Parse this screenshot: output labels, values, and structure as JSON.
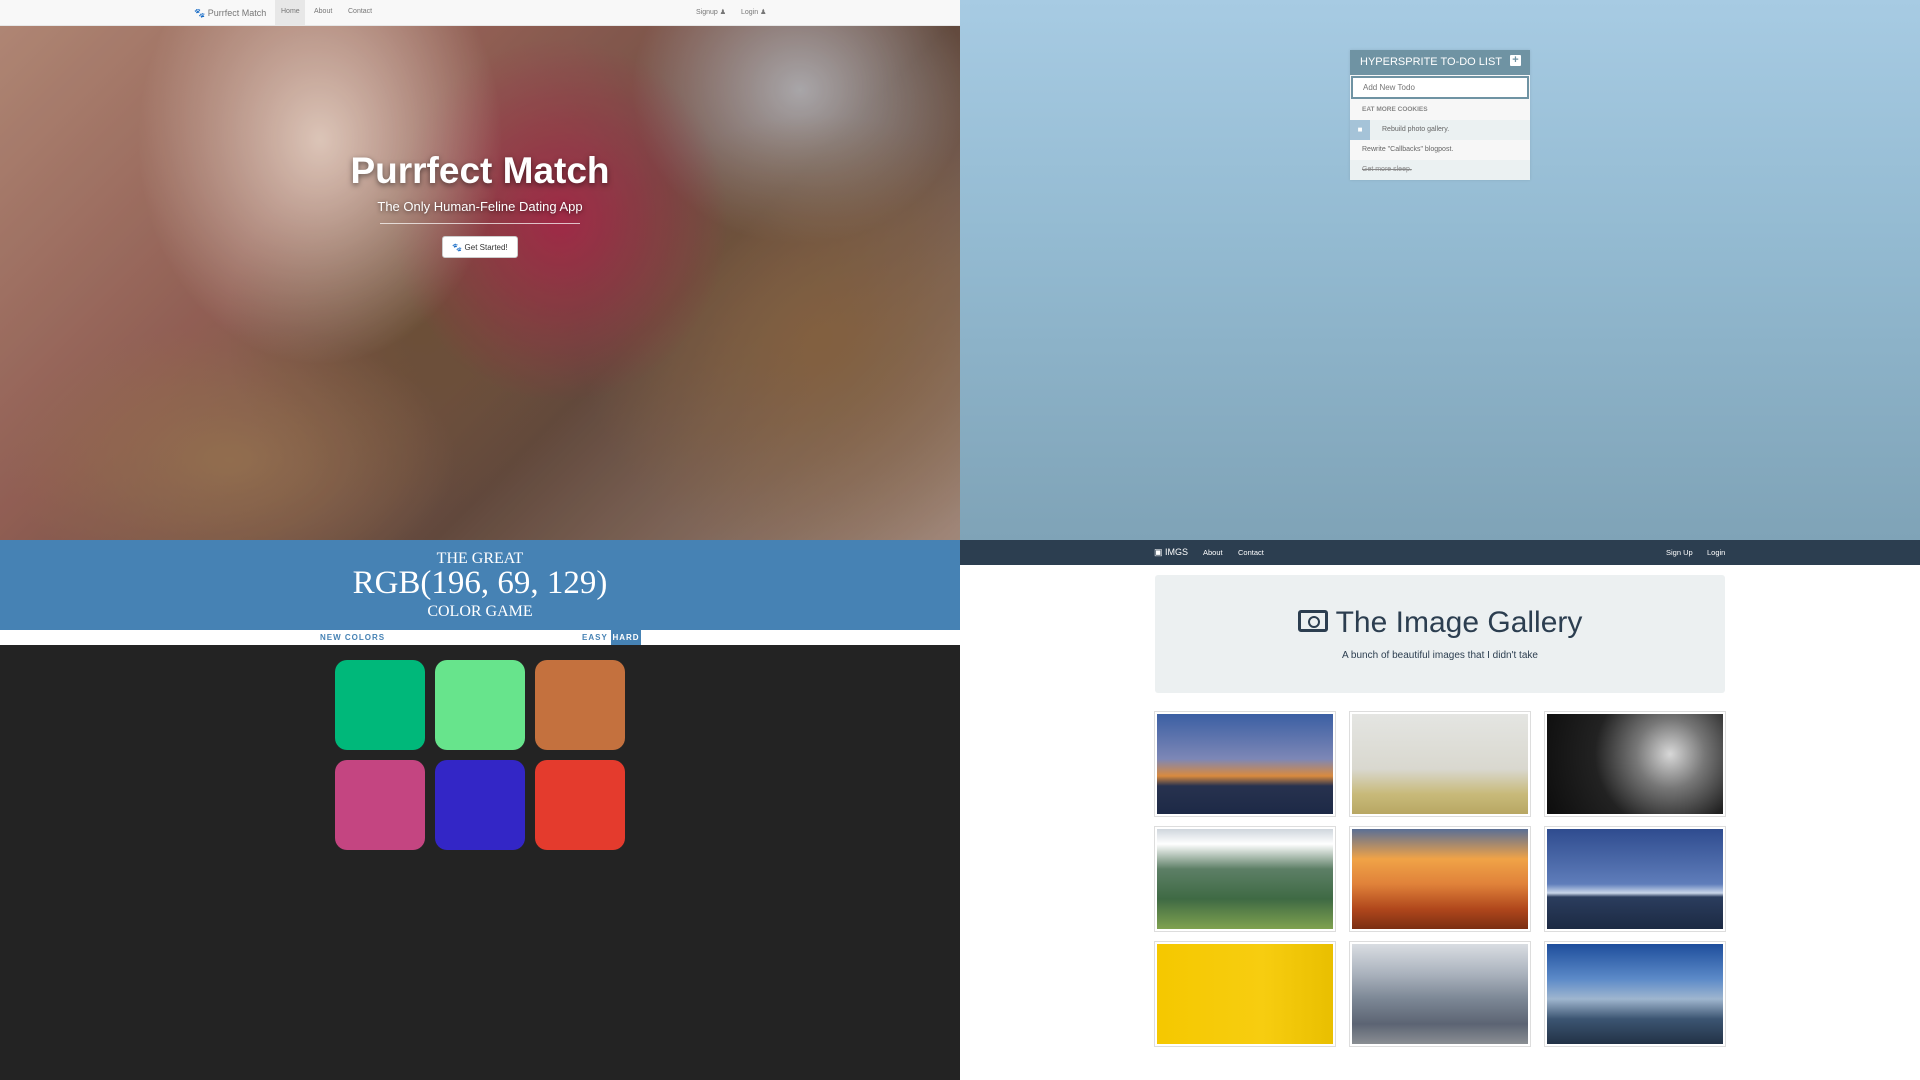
{
  "purrfect": {
    "brand": "Purrfect Match",
    "nav": [
      "Home",
      "About",
      "Contact"
    ],
    "signup": "Signup",
    "login": "Login",
    "title": "Purrfect Match",
    "subtitle": "The Only Human-Feline Dating App",
    "cta": "Get Started!"
  },
  "todo": {
    "title": "HYPERSPRITE TO-DO LIST",
    "placeholder": "Add New Todo",
    "items": [
      {
        "text": "EAT MORE COOKIES",
        "style": "header"
      },
      {
        "text": "Rebuild photo gallery.",
        "style": "hover"
      },
      {
        "text": "Rewrite \"Callbacks\" blogpost.",
        "style": "normal"
      },
      {
        "text": "Get more sleep.",
        "style": "done"
      }
    ]
  },
  "colorgame": {
    "line1": "THE GREAT",
    "rgb": "RGB(196, 69, 129)",
    "line3": "COLOR GAME",
    "new_colors": "NEW COLORS",
    "easy": "EASY",
    "hard": "HARD",
    "squares": [
      "#00b87a",
      "#67e48c",
      "#c4713e",
      "#c44581",
      "#3326c6",
      "#e43b2d"
    ]
  },
  "gallery": {
    "brand": "IMGS",
    "nav": [
      "About",
      "Contact"
    ],
    "signup": "Sign Up",
    "login": "Login",
    "title": "The Image Gallery",
    "subtitle": "A bunch of beautiful images that I didn't take",
    "thumbs": [
      "golden-gate-bridge",
      "foggy-field",
      "spiral-architecture",
      "mountain-meadow",
      "sunset-clouds",
      "ocean-horizon",
      "yellow-wall",
      "city-skyline",
      "mountain-valley"
    ]
  },
  "colors": {
    "steelblue": "#4682b4",
    "todo_header": "#6f93a3",
    "gallery_nav": "#2c3e50"
  }
}
